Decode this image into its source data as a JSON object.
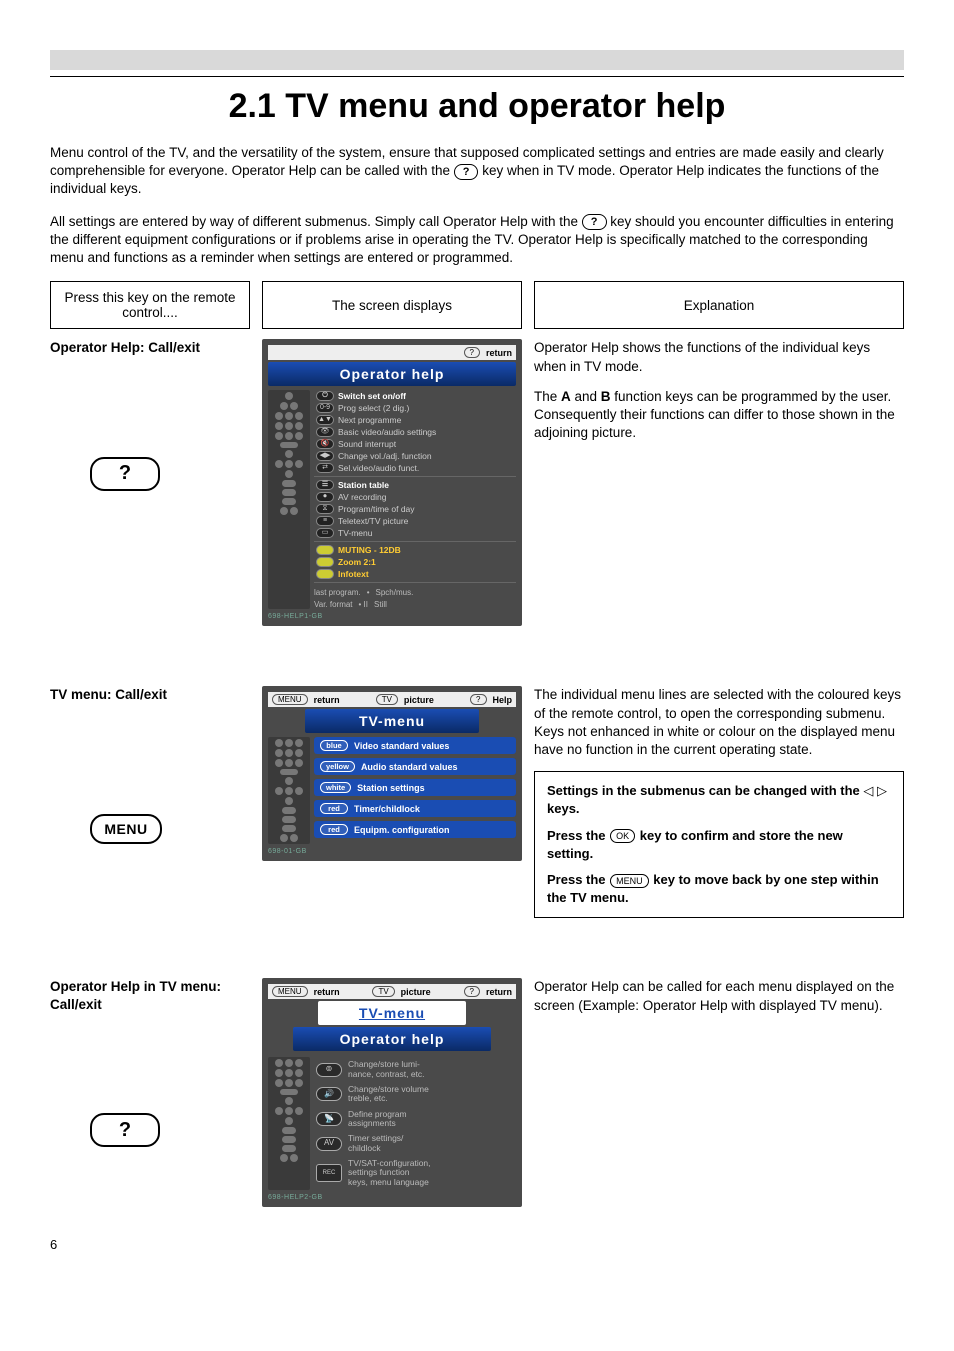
{
  "page_number": "6",
  "title": "2.1 TV menu and operator help",
  "intro1_a": "Menu control of the TV, and the versatility of the system, ensure that supposed complicated settings and entries are made easily and clearly comprehensible for everyone. Operator Help can be called with the ",
  "intro1_key": "?",
  "intro1_b": " key when in TV mode. Operator Help indicates the functions of the individual keys.",
  "intro2_a": "All settings are entered by way of different submenus. Simply call Operator Help with the ",
  "intro2_key": "?",
  "intro2_b": " key should you encounter difficulties in entering the different equipment configurations or if problems arise in operating the TV. Operator Help is specifically matched to the corresponding menu and functions as a reminder when settings are entered or programmed.",
  "header": {
    "left": "Press this key on the remote control....",
    "mid": "The screen displays",
    "right": "Explanation"
  },
  "sec1": {
    "left_title": "Operator Help: Call/exit",
    "key_label": "?",
    "right_p1": "Operator Help shows the functions of the individual keys when in TV mode.",
    "right_p2_a": "The ",
    "right_p2_bold1": "A",
    "right_p2_mid": " and ",
    "right_p2_bold2": "B",
    "right_p2_b": " function keys can be programmed by the user. Consequently their functions can differ to those shown in the adjoining picture.",
    "osd": {
      "top_right_key": "?",
      "top_right_label": "return",
      "title": "Operator help",
      "lines": [
        "Switch set on/off",
        "Prog select        (2 dig.)",
        "Next programme",
        "Basic video/audio settings",
        "Sound interrupt",
        "Change vol./adj. function",
        "Sel.video/audio funct."
      ],
      "lines2": [
        "Station table",
        "AV recording",
        "Program/time of day",
        "Teletext/TV picture",
        "TV-menu"
      ],
      "lines3": [
        "MUTING - 12DB",
        "Zoom 2:1",
        "Infotext"
      ],
      "footer_left": "last program.",
      "footer_mid": "Var. format",
      "footer_r1": "Spch/mus.",
      "footer_r2": "Still",
      "id": "698-HELP1-GB"
    }
  },
  "sec2": {
    "left_title": "TV menu: Call/exit",
    "key_label": "MENU",
    "right_p1": "The individual menu lines are selected with the coloured keys of the remote control, to open the corresponding submenu. Keys not enhanced in white or colour on the displayed menu have no function in the current operating state.",
    "callout": {
      "p1_a": "Settings in the submenus can be changed with the ",
      "p1_arrows": "◁ ▷",
      "p1_b": " keys.",
      "p2_a": "Press the ",
      "p2_key": "OK",
      "p2_b": " key to confirm and store the new setting.",
      "p3_a": "Press the ",
      "p3_key": "MENU",
      "p3_b": " key to move back by one step within the TV menu."
    },
    "osd": {
      "top_menu_key": "MENU",
      "top_menu_label": "return",
      "top_tv_key": "TV",
      "top_tv_label": "picture",
      "top_help_key": "?",
      "top_help_label": "Help",
      "title": "TV-menu",
      "items": [
        {
          "tag": "blue",
          "label": "Video standard values"
        },
        {
          "tag": "yellow",
          "label": "Audio standard values"
        },
        {
          "tag": "white",
          "label": "Station settings"
        },
        {
          "tag": "red",
          "label": "Timer/childlock"
        },
        {
          "tag": "red",
          "label": "Equipm. configuration"
        }
      ],
      "id": "698-01-GB"
    }
  },
  "sec3": {
    "left_title": "Operator Help in TV menu: Call/exit",
    "key_label": "?",
    "right_p1": "Operator Help can be called for each menu displayed on the screen (Example: Operator Help with displayed TV menu).",
    "osd": {
      "top_menu_key": "MENU",
      "top_menu_label": "return",
      "top_tv_key": "TV",
      "top_tv_label": "picture",
      "top_help_key": "?",
      "top_help_label": "return",
      "title1": "TV-menu",
      "title2": "Operator help",
      "lines": [
        {
          "ic": "⊚",
          "text": "Change/store lumi-\nnance, contrast, etc."
        },
        {
          "ic": "🔊",
          "text": "Change/store volume\ntreble, etc."
        },
        {
          "ic": "📡",
          "text": "Define program\nassignments"
        },
        {
          "ic": "AV",
          "text": "Timer settings/\nchildlock"
        },
        {
          "ic": "REC",
          "text": "TV/SAT-configuration,\nsettings function\nkeys, menu language"
        }
      ],
      "id": "698-HELP2-GB"
    }
  }
}
